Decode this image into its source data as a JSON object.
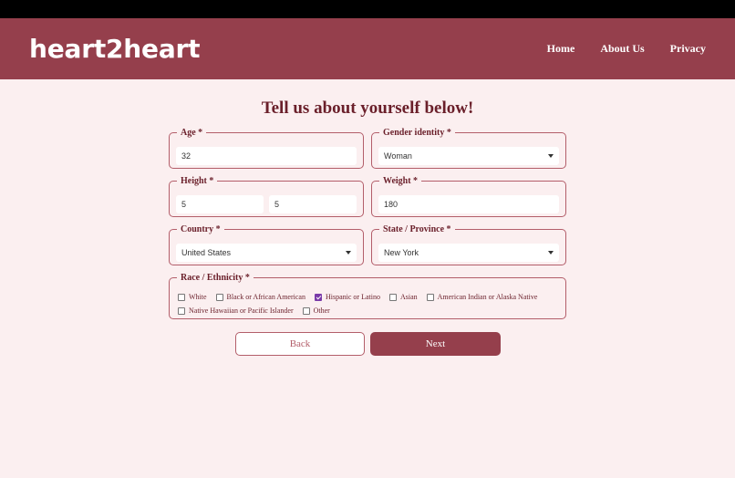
{
  "header": {
    "logo": "heart2heart",
    "nav": [
      "Home",
      "About Us",
      "Privacy"
    ]
  },
  "form": {
    "title": "Tell us about yourself below!",
    "age": {
      "label": "Age *",
      "value": "32"
    },
    "gender": {
      "label": "Gender identity *",
      "value": "Woman"
    },
    "height": {
      "label": "Height *",
      "feet": "5",
      "inches": "5"
    },
    "weight": {
      "label": "Weight *",
      "value": "180"
    },
    "country": {
      "label": "Country *",
      "value": "United States"
    },
    "state": {
      "label": "State / Province *",
      "value": "New York"
    },
    "race": {
      "label": "Race / Ethnicity *",
      "options": [
        {
          "label": "White",
          "checked": false
        },
        {
          "label": "Black or African American",
          "checked": false
        },
        {
          "label": "Hispanic or Latino",
          "checked": true
        },
        {
          "label": "Asian",
          "checked": false
        },
        {
          "label": "American Indian or Alaska Native",
          "checked": false
        },
        {
          "label": "Native Hawaiian or Pacific Islander",
          "checked": false
        },
        {
          "label": "Other",
          "checked": false
        }
      ]
    },
    "buttons": {
      "back": "Back",
      "next": "Next"
    }
  },
  "colors": {
    "brand": "#953f4c",
    "background": "#fbeff0",
    "text": "#6a1f2a",
    "checkbox_checked": "#7a3aa8"
  }
}
